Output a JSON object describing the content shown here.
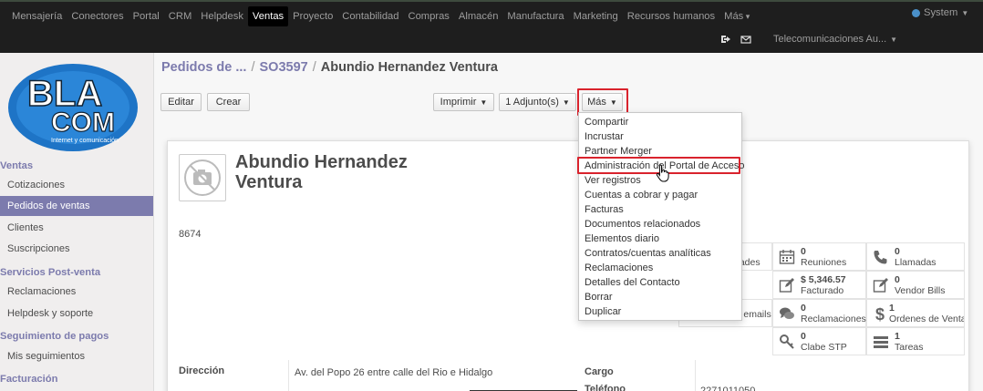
{
  "navbar": {
    "items": [
      "Mensajería",
      "Conectores",
      "Portal",
      "CRM",
      "Helpdesk",
      "Ventas",
      "Proyecto",
      "Contabilidad",
      "Compras",
      "Almacén",
      "Manufactura",
      "Marketing",
      "Recursos humanos",
      "Más"
    ],
    "active_index": 5,
    "user": "System",
    "company": "Telecomunicaciones Au..."
  },
  "logo": {
    "line1": "BLA",
    "line2": "COM",
    "tagline": "Internet y comunicación"
  },
  "sidebar": {
    "sections": [
      {
        "title": "Ventas",
        "items": [
          "Cotizaciones",
          "Pedidos de ventas",
          "Clientes",
          "Suscripciones"
        ]
      },
      {
        "title": "Servicios Post-venta",
        "items": [
          "Reclamaciones",
          "Helpdesk y soporte"
        ]
      },
      {
        "title": "Seguimiento de pagos",
        "items": [
          "Mis seguimientos"
        ]
      },
      {
        "title": "Facturación",
        "items": []
      }
    ],
    "active_item": "Pedidos de ventas"
  },
  "breadcrumb": {
    "parent": "Pedidos de ...",
    "order": "SO3597",
    "current": "Abundio Hernandez Ventura"
  },
  "toolbar": {
    "edit": "Editar",
    "create": "Crear",
    "print": "Imprimir",
    "attachments": "1 Adjunto(s)",
    "more": "Más"
  },
  "more_menu": {
    "items": [
      "Compartir",
      "Incrustar",
      "Partner Merger",
      "Administración del Portal de Acceso",
      "Ver registros",
      "Cuentas a cobrar y pagar",
      "Facturas",
      "Documentos relacionados",
      "Elementos diario",
      "Contratos/cuentas analíticas",
      "Reclamaciones",
      "Detalles del Contacto",
      "Borrar",
      "Duplicar"
    ],
    "highlighted": "Administración del Portal de Acceso"
  },
  "partner": {
    "name_line1": "Abundio Hernandez",
    "name_line2": "Ventura",
    "ref": "8674"
  },
  "smart_buttons": {
    "activities_partial": "dades",
    "emails_partial": "Pasados de emails",
    "meetings": {
      "value": "0",
      "label": "Reuniones"
    },
    "calls": {
      "value": "0",
      "label": "Llamadas"
    },
    "invoiced": {
      "value": "$ 5,346.57",
      "label": "Facturado"
    },
    "vendor_bills": {
      "value": "0",
      "label": "Vendor Bills"
    },
    "claims": {
      "value": "0",
      "label": "Reclamaciones"
    },
    "sales_orders": {
      "value": "1",
      "label": "Ordenes de Venta"
    },
    "stp": {
      "value": "0",
      "label": "Clabe STP"
    },
    "tasks": {
      "value": "1",
      "label": "Tareas"
    }
  },
  "fields": {
    "address_label": "Dirección",
    "address_value": "Av. del Popo 26 entre calle del Rio e Hidalgo",
    "job_label": "Cargo",
    "phone_label": "Teléfono",
    "phone_value": "2271011050"
  }
}
